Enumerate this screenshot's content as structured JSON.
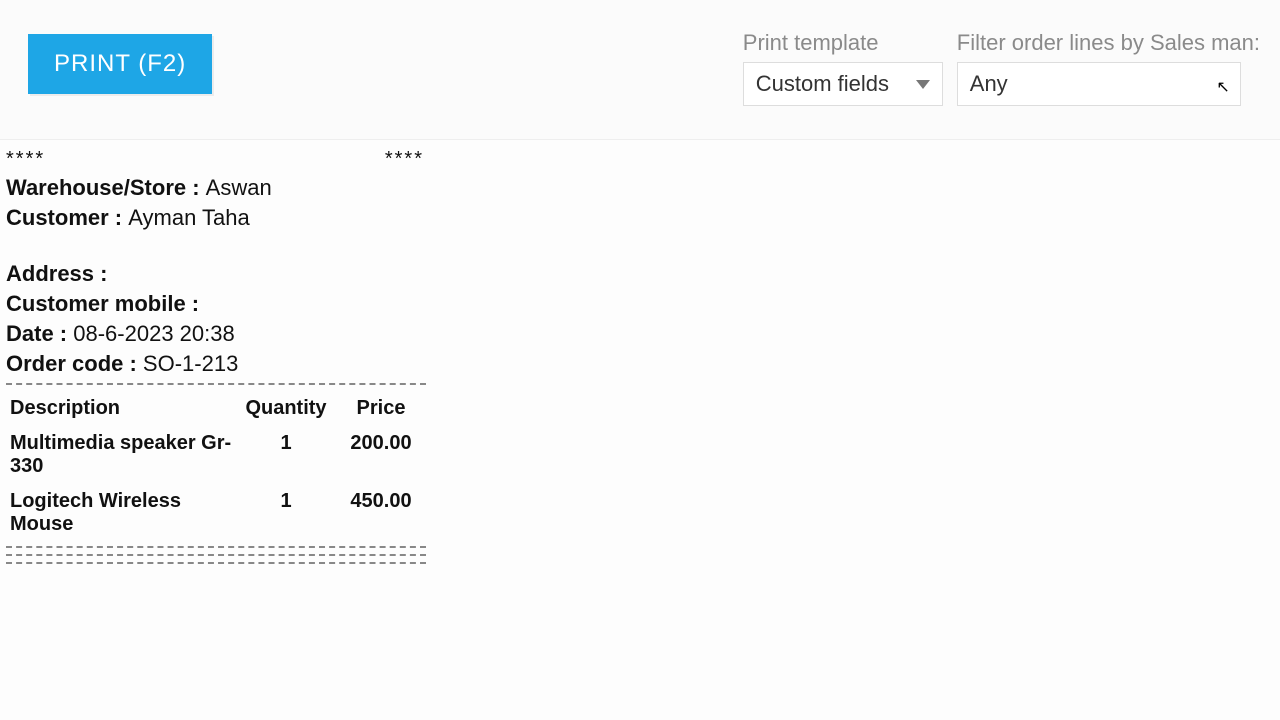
{
  "toolbar": {
    "print_label": "PRINT (F2)",
    "template_label": "Print template",
    "template_value": "Custom fields",
    "salesman_label": "Filter order lines by Sales man:",
    "salesman_value": "Any"
  },
  "receipt": {
    "stars": "****",
    "warehouse_label": "Warehouse/Store : ",
    "warehouse_value": "Aswan",
    "customer_label": "Customer : ",
    "customer_value": "Ayman Taha",
    "address_label": "Address :",
    "mobile_label": "Customer mobile :",
    "date_label": "Date : ",
    "date_value": "08-6-2023 20:38",
    "order_label": "Order code : ",
    "order_value": "SO-1-213",
    "headers": {
      "desc": "Description",
      "qty": "Quantity",
      "price": "Price"
    },
    "items": [
      {
        "desc": "Multimedia speaker Gr-330",
        "qty": "1",
        "price": "200.00"
      },
      {
        "desc": "Logitech Wireless Mouse",
        "qty": "1",
        "price": "450.00"
      }
    ]
  }
}
